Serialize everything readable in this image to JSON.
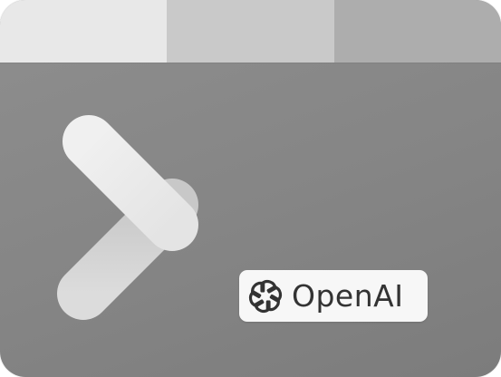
{
  "badge": {
    "brand_text": "OpenAI"
  },
  "icons": {
    "main": "terminal-prompt-icon",
    "brand_logo": "openai-logo-icon"
  },
  "colors": {
    "body_bg": "#858585",
    "tab_light": "#e8e8e8",
    "tab_mid": "#c9c9c9",
    "tab_dark": "#adadad",
    "chevron_light": "#ececec",
    "chevron_shade": "#d2d2d2",
    "badge_bg": "#f7f7f7",
    "badge_text": "#333333"
  }
}
